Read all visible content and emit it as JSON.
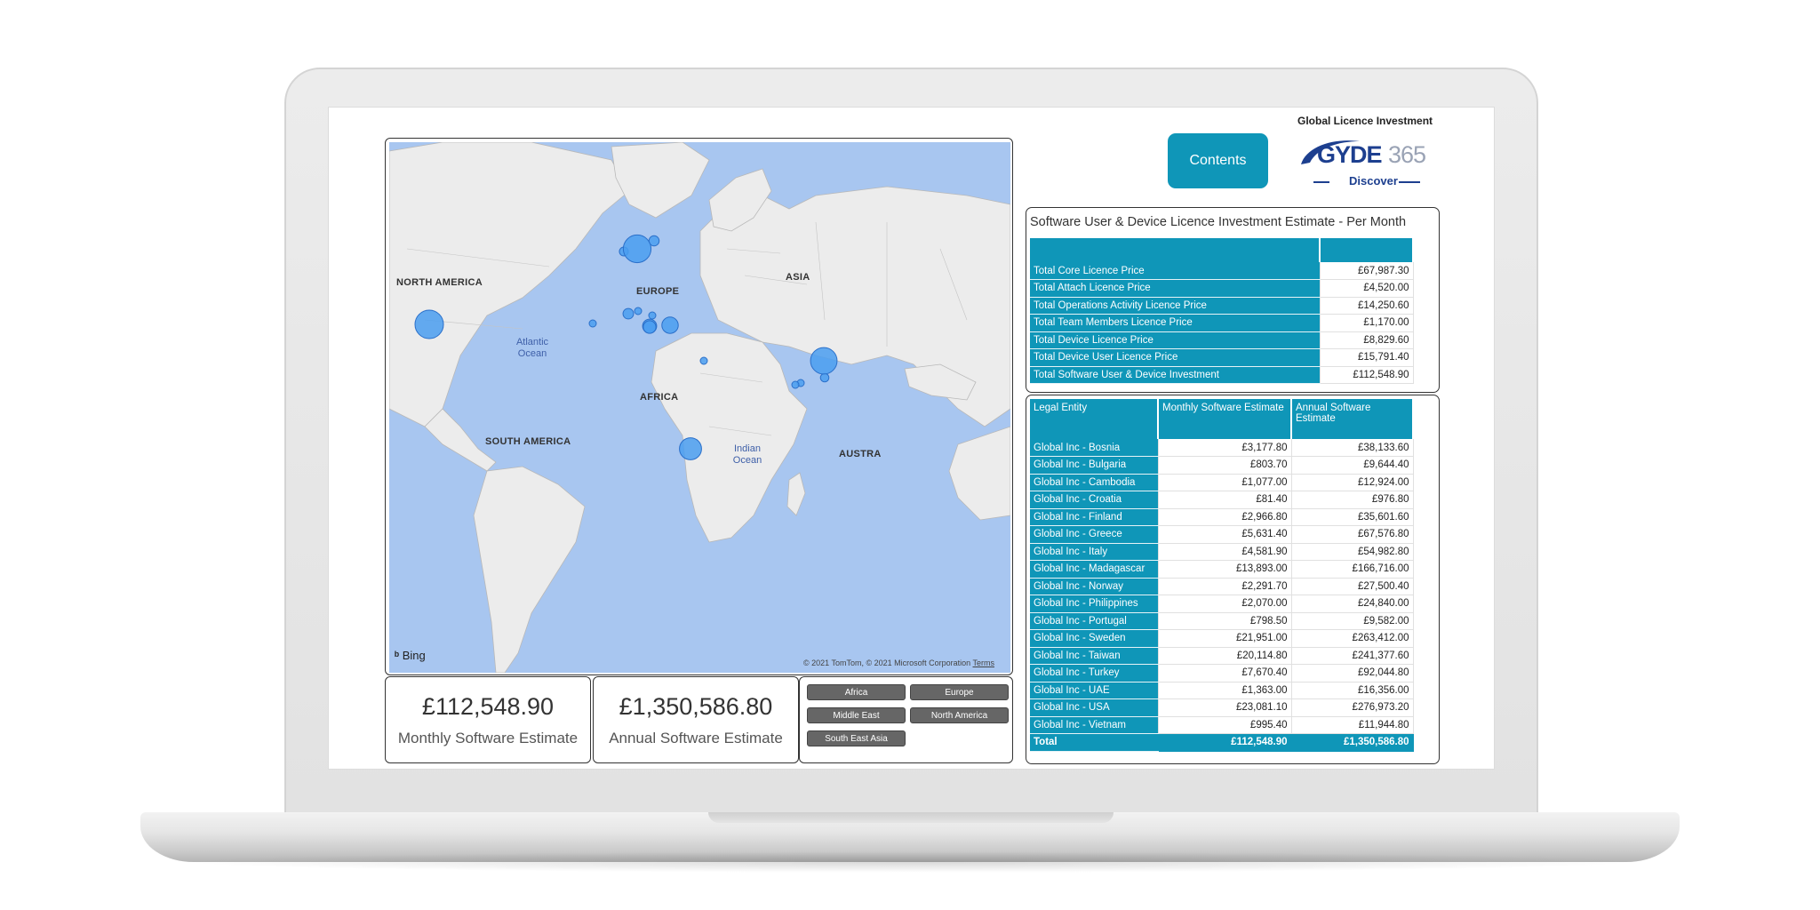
{
  "report": {
    "title": "Global Licence Investment",
    "contents_label": "Contents",
    "logo": {
      "brand": "GYDE",
      "number": "365",
      "tagline": "Discover"
    }
  },
  "map": {
    "regions": [
      "NORTH AMERICA",
      "EUROPE",
      "ASIA",
      "AFRICA",
      "SOUTH AMERICA",
      "AUSTRA"
    ],
    "oceans": [
      "Atlantic Ocean",
      "Indian Ocean"
    ],
    "provider": "Bing",
    "copyright": "© 2021 TomTom, © 2021 Microsoft Corporation",
    "terms": "Terms"
  },
  "kpis": {
    "monthly": {
      "value": "£112,548.90",
      "label": "Monthly Software Estimate"
    },
    "annual": {
      "value": "£1,350,586.80",
      "label": "Annual Software Estimate"
    }
  },
  "slicers": [
    "Africa",
    "Europe",
    "Middle East",
    "North America",
    "South East Asia"
  ],
  "licence_table": {
    "title": "Software User & Device Licence Investment Estimate - Per Month",
    "rows": [
      {
        "label": "Total Core Licence Price",
        "value": "£67,987.30"
      },
      {
        "label": "Total Attach Licence Price",
        "value": "£4,520.00"
      },
      {
        "label": "Total Operations Activity Licence Price",
        "value": "£14,250.60"
      },
      {
        "label": "Total Team Members Licence Price",
        "value": "£1,170.00"
      },
      {
        "label": "Total Device Licence Price",
        "value": "£8,829.60"
      },
      {
        "label": "Total Device User Licence Price",
        "value": "£15,791.40"
      },
      {
        "label": "Total Software User & Device Investment",
        "value": "£112,548.90"
      }
    ]
  },
  "entity_table": {
    "headers": [
      "Legal Entity",
      "Monthly Software Estimate",
      "Annual Software Estimate"
    ],
    "rows": [
      {
        "entity": "Global Inc - Bosnia",
        "monthly": "£3,177.80",
        "annual": "£38,133.60"
      },
      {
        "entity": "Global Inc - Bulgaria",
        "monthly": "£803.70",
        "annual": "£9,644.40"
      },
      {
        "entity": "Global Inc - Cambodia",
        "monthly": "£1,077.00",
        "annual": "£12,924.00"
      },
      {
        "entity": "Global Inc - Croatia",
        "monthly": "£81.40",
        "annual": "£976.80"
      },
      {
        "entity": "Global Inc - Finland",
        "monthly": "£2,966.80",
        "annual": "£35,601.60"
      },
      {
        "entity": "Global Inc - Greece",
        "monthly": "£5,631.40",
        "annual": "£67,576.80"
      },
      {
        "entity": "Global Inc - Italy",
        "monthly": "£4,581.90",
        "annual": "£54,982.80"
      },
      {
        "entity": "Global Inc - Madagascar",
        "monthly": "£13,893.00",
        "annual": "£166,716.00"
      },
      {
        "entity": "Global Inc - Norway",
        "monthly": "£2,291.70",
        "annual": "£27,500.40"
      },
      {
        "entity": "Global Inc - Philippines",
        "monthly": "£2,070.00",
        "annual": "£24,840.00"
      },
      {
        "entity": "Global Inc - Portugal",
        "monthly": "£798.50",
        "annual": "£9,582.00"
      },
      {
        "entity": "Global Inc - Sweden",
        "monthly": "£21,951.00",
        "annual": "£263,412.00"
      },
      {
        "entity": "Global Inc - Taiwan",
        "monthly": "£20,114.80",
        "annual": "£241,377.60"
      },
      {
        "entity": "Global Inc - Turkey",
        "monthly": "£7,670.40",
        "annual": "£92,044.80"
      },
      {
        "entity": "Global Inc - UAE",
        "monthly": "£1,363.00",
        "annual": "£16,356.00"
      },
      {
        "entity": "Global Inc - USA",
        "monthly": "£23,081.10",
        "annual": "£276,973.20"
      },
      {
        "entity": "Global Inc - Vietnam",
        "monthly": "£995.40",
        "annual": "£11,944.80"
      }
    ],
    "total": {
      "label": "Total",
      "monthly": "£112,548.90",
      "annual": "£1,350,586.80"
    }
  },
  "colors": {
    "accent": "#0f96b8",
    "bubble": "#4a9ef0",
    "ocean": "#a8c6f0",
    "land": "#ececec"
  }
}
